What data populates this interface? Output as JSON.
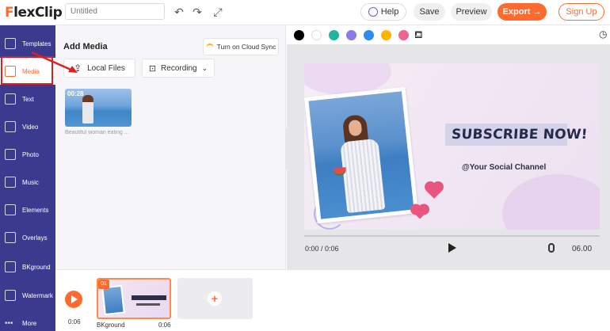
{
  "app": {
    "logo": "FlexClip",
    "title_placeholder": "Untitled"
  },
  "toolbar": {
    "help_label": "Help",
    "save_label": "Save",
    "preview_label": "Preview",
    "export_label": "Export",
    "signup_label": "Sign Up"
  },
  "sidebar": {
    "items": [
      {
        "label": "Templates",
        "icon": "templates-icon"
      },
      {
        "label": "Media",
        "icon": "media-icon",
        "active": true
      },
      {
        "label": "Text",
        "icon": "text-icon"
      },
      {
        "label": "Video",
        "icon": "video-icon"
      },
      {
        "label": "Photo",
        "icon": "photo-icon"
      },
      {
        "label": "Music",
        "icon": "music-icon"
      },
      {
        "label": "Elements",
        "icon": "elements-icon"
      },
      {
        "label": "Overlays",
        "icon": "overlays-icon"
      },
      {
        "label": "BKground",
        "icon": "background-icon"
      },
      {
        "label": "Watermark",
        "icon": "watermark-icon"
      },
      {
        "label": "More",
        "icon": "more-icon"
      }
    ]
  },
  "media_panel": {
    "title": "Add Media",
    "cloud_sync_label": "Turn on Cloud Sync",
    "local_files_label": "Local Files",
    "recording_label": "Recording",
    "items": [
      {
        "duration": "00:28",
        "caption": "Beautiful woman eating ..."
      }
    ]
  },
  "color_palette": [
    "#000000",
    "#ffffff",
    "#1fb5a0",
    "#8c7ae6",
    "#2d8cf0",
    "#ffb400",
    "#f06292"
  ],
  "canvas": {
    "headline": "SUBSCRIBE NOW!",
    "social": "@Your Social Channel"
  },
  "player": {
    "current_time": "0:00 / 0:06",
    "duration": "06.00",
    "progress": 0
  },
  "timeline": {
    "time": "0:06",
    "clips": [
      {
        "index": "01",
        "label": "BKground",
        "duration": "0:06"
      }
    ]
  },
  "colors": {
    "accent": "#ff6a2f",
    "sidebar_bg": "#3b3a8f"
  }
}
